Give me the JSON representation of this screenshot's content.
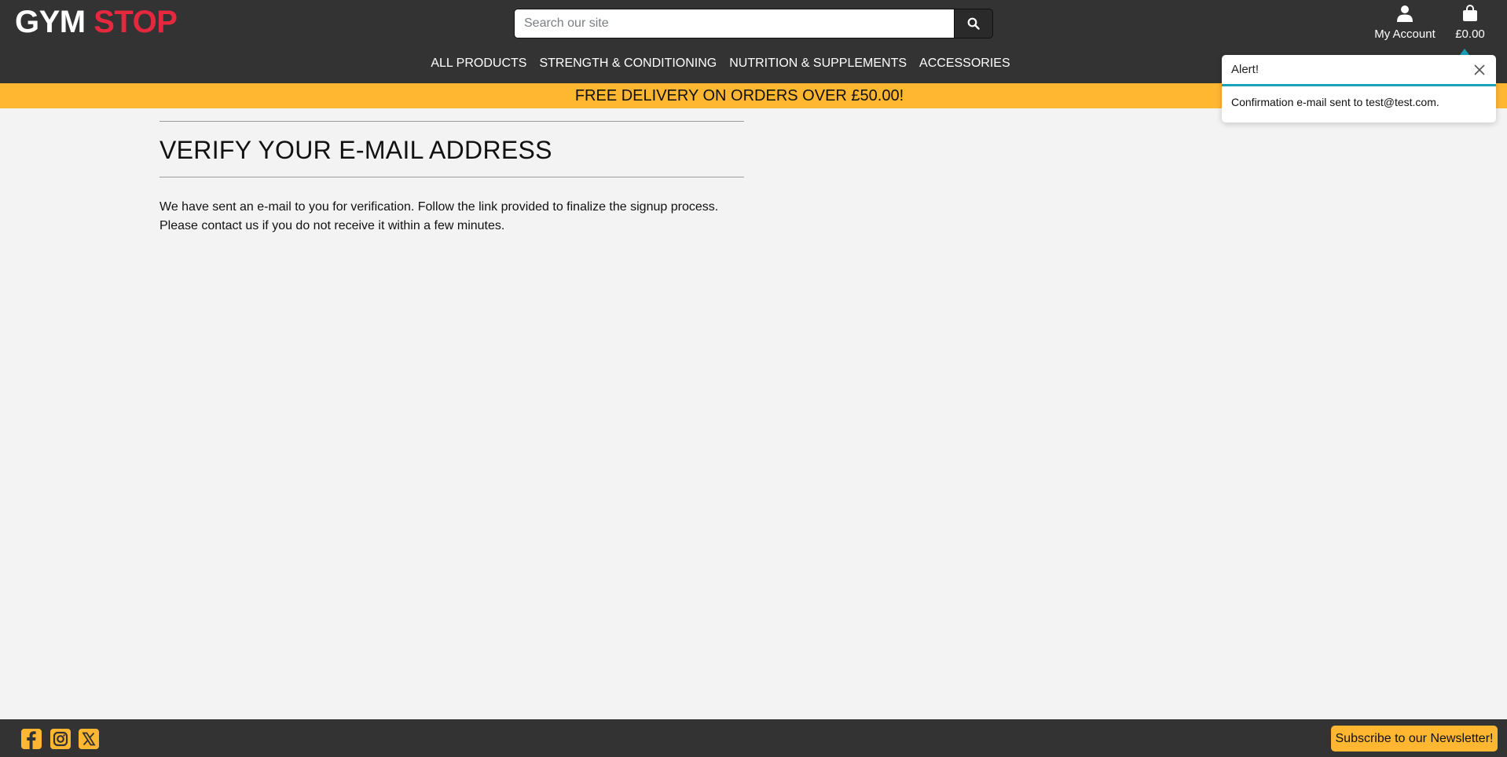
{
  "header": {
    "logo_part1": "GYM",
    "logo_part2": "STOP",
    "search_placeholder": "Search our site",
    "account_label": "My Account",
    "bag_total": "£0.00"
  },
  "nav": {
    "items": [
      "ALL PRODUCTS",
      "STRENGTH & CONDITIONING",
      "NUTRITION & SUPPLEMENTS",
      "ACCESSORIES"
    ]
  },
  "banner": {
    "text": "FREE DELIVERY ON ORDERS OVER £50.00!"
  },
  "main": {
    "title": "VERIFY YOUR E-MAIL ADDRESS",
    "message": "We have sent an e-mail to you for verification. Follow the link provided to finalize the signup process. Please contact us if you do not receive it within a few minutes."
  },
  "toast": {
    "title": "Alert!",
    "message": "Confirmation e-mail sent to test@test.com."
  },
  "footer": {
    "social_icons": [
      "facebook-icon",
      "instagram-icon",
      "x-icon"
    ],
    "newsletter_label": "Subscribe to our Newsletter!"
  },
  "colors": {
    "header_bg": "#333333",
    "brand_red": "#e6283f",
    "accent_yellow": "#ffb732",
    "toast_accent": "#17a2b8",
    "page_bg": "#f3f3f3"
  }
}
